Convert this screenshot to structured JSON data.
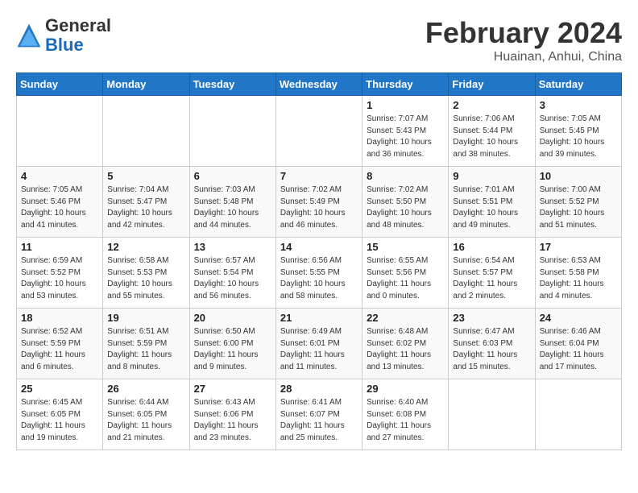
{
  "header": {
    "logo_general": "General",
    "logo_blue": "Blue",
    "month": "February 2024",
    "location": "Huainan, Anhui, China"
  },
  "days_of_week": [
    "Sunday",
    "Monday",
    "Tuesday",
    "Wednesday",
    "Thursday",
    "Friday",
    "Saturday"
  ],
  "weeks": [
    [
      {
        "day": "",
        "info": ""
      },
      {
        "day": "",
        "info": ""
      },
      {
        "day": "",
        "info": ""
      },
      {
        "day": "",
        "info": ""
      },
      {
        "day": "1",
        "info": "Sunrise: 7:07 AM\nSunset: 5:43 PM\nDaylight: 10 hours\nand 36 minutes."
      },
      {
        "day": "2",
        "info": "Sunrise: 7:06 AM\nSunset: 5:44 PM\nDaylight: 10 hours\nand 38 minutes."
      },
      {
        "day": "3",
        "info": "Sunrise: 7:05 AM\nSunset: 5:45 PM\nDaylight: 10 hours\nand 39 minutes."
      }
    ],
    [
      {
        "day": "4",
        "info": "Sunrise: 7:05 AM\nSunset: 5:46 PM\nDaylight: 10 hours\nand 41 minutes."
      },
      {
        "day": "5",
        "info": "Sunrise: 7:04 AM\nSunset: 5:47 PM\nDaylight: 10 hours\nand 42 minutes."
      },
      {
        "day": "6",
        "info": "Sunrise: 7:03 AM\nSunset: 5:48 PM\nDaylight: 10 hours\nand 44 minutes."
      },
      {
        "day": "7",
        "info": "Sunrise: 7:02 AM\nSunset: 5:49 PM\nDaylight: 10 hours\nand 46 minutes."
      },
      {
        "day": "8",
        "info": "Sunrise: 7:02 AM\nSunset: 5:50 PM\nDaylight: 10 hours\nand 48 minutes."
      },
      {
        "day": "9",
        "info": "Sunrise: 7:01 AM\nSunset: 5:51 PM\nDaylight: 10 hours\nand 49 minutes."
      },
      {
        "day": "10",
        "info": "Sunrise: 7:00 AM\nSunset: 5:52 PM\nDaylight: 10 hours\nand 51 minutes."
      }
    ],
    [
      {
        "day": "11",
        "info": "Sunrise: 6:59 AM\nSunset: 5:52 PM\nDaylight: 10 hours\nand 53 minutes."
      },
      {
        "day": "12",
        "info": "Sunrise: 6:58 AM\nSunset: 5:53 PM\nDaylight: 10 hours\nand 55 minutes."
      },
      {
        "day": "13",
        "info": "Sunrise: 6:57 AM\nSunset: 5:54 PM\nDaylight: 10 hours\nand 56 minutes."
      },
      {
        "day": "14",
        "info": "Sunrise: 6:56 AM\nSunset: 5:55 PM\nDaylight: 10 hours\nand 58 minutes."
      },
      {
        "day": "15",
        "info": "Sunrise: 6:55 AM\nSunset: 5:56 PM\nDaylight: 11 hours\nand 0 minutes."
      },
      {
        "day": "16",
        "info": "Sunrise: 6:54 AM\nSunset: 5:57 PM\nDaylight: 11 hours\nand 2 minutes."
      },
      {
        "day": "17",
        "info": "Sunrise: 6:53 AM\nSunset: 5:58 PM\nDaylight: 11 hours\nand 4 minutes."
      }
    ],
    [
      {
        "day": "18",
        "info": "Sunrise: 6:52 AM\nSunset: 5:59 PM\nDaylight: 11 hours\nand 6 minutes."
      },
      {
        "day": "19",
        "info": "Sunrise: 6:51 AM\nSunset: 5:59 PM\nDaylight: 11 hours\nand 8 minutes."
      },
      {
        "day": "20",
        "info": "Sunrise: 6:50 AM\nSunset: 6:00 PM\nDaylight: 11 hours\nand 9 minutes."
      },
      {
        "day": "21",
        "info": "Sunrise: 6:49 AM\nSunset: 6:01 PM\nDaylight: 11 hours\nand 11 minutes."
      },
      {
        "day": "22",
        "info": "Sunrise: 6:48 AM\nSunset: 6:02 PM\nDaylight: 11 hours\nand 13 minutes."
      },
      {
        "day": "23",
        "info": "Sunrise: 6:47 AM\nSunset: 6:03 PM\nDaylight: 11 hours\nand 15 minutes."
      },
      {
        "day": "24",
        "info": "Sunrise: 6:46 AM\nSunset: 6:04 PM\nDaylight: 11 hours\nand 17 minutes."
      }
    ],
    [
      {
        "day": "25",
        "info": "Sunrise: 6:45 AM\nSunset: 6:05 PM\nDaylight: 11 hours\nand 19 minutes."
      },
      {
        "day": "26",
        "info": "Sunrise: 6:44 AM\nSunset: 6:05 PM\nDaylight: 11 hours\nand 21 minutes."
      },
      {
        "day": "27",
        "info": "Sunrise: 6:43 AM\nSunset: 6:06 PM\nDaylight: 11 hours\nand 23 minutes."
      },
      {
        "day": "28",
        "info": "Sunrise: 6:41 AM\nSunset: 6:07 PM\nDaylight: 11 hours\nand 25 minutes."
      },
      {
        "day": "29",
        "info": "Sunrise: 6:40 AM\nSunset: 6:08 PM\nDaylight: 11 hours\nand 27 minutes."
      },
      {
        "day": "",
        "info": ""
      },
      {
        "day": "",
        "info": ""
      }
    ]
  ]
}
